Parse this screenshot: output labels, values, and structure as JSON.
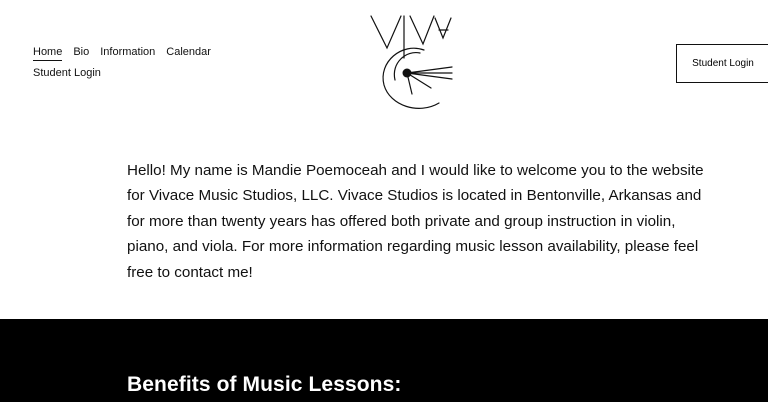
{
  "nav": {
    "items": [
      {
        "label": "Home",
        "active": true
      },
      {
        "label": "Bio",
        "active": false
      },
      {
        "label": "Information",
        "active": false
      },
      {
        "label": "Calendar",
        "active": false
      },
      {
        "label": "Student Login",
        "active": false
      }
    ]
  },
  "logo": {
    "icon": "vivace-logo-icon",
    "text": "VIVA"
  },
  "header": {
    "login_button": "Student Login"
  },
  "main": {
    "welcome_text": "Hello!  My name is Mandie Poemoceah and I would like to welcome you to the website for Vivace Music Studios, LLC.  Vivace Studios is located in Bentonville, Arkansas and for more than twenty years has offered both private and group instruction in violin, piano, and viola.  For more information regarding music lesson availability, please feel free to contact me!"
  },
  "benefits": {
    "heading": "Benefits of Music Lessons:"
  },
  "colors": {
    "text": "#111111",
    "background": "#ffffff",
    "band": "#000000"
  }
}
